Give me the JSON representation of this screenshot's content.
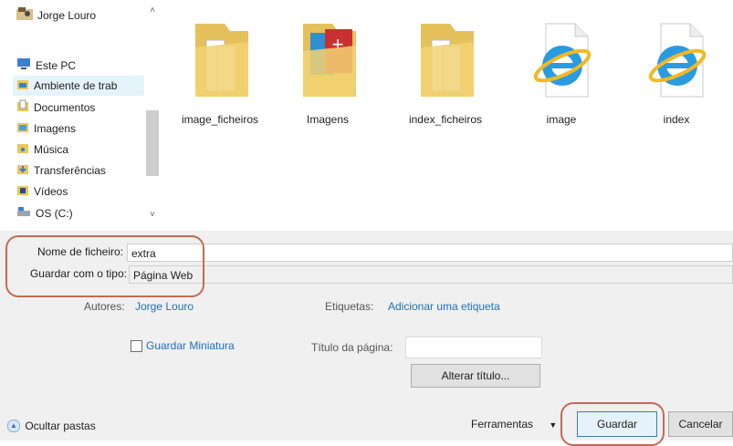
{
  "nav": {
    "items": [
      {
        "label": "Jorge Louro",
        "icon": "user-folder-icon"
      },
      {
        "label": "Este PC",
        "icon": "computer-icon"
      },
      {
        "label": "Ambiente de trab",
        "icon": "desktop-folder-icon"
      },
      {
        "label": "Documentos",
        "icon": "documents-folder-icon"
      },
      {
        "label": "Imagens",
        "icon": "pictures-folder-icon"
      },
      {
        "label": "Música",
        "icon": "music-folder-icon"
      },
      {
        "label": "Transferências",
        "icon": "downloads-folder-icon"
      },
      {
        "label": "Vídeos",
        "icon": "videos-folder-icon"
      },
      {
        "label": "OS (C:)",
        "icon": "drive-icon"
      }
    ]
  },
  "files": [
    {
      "label": "image_ficheiros",
      "icon": "folder-icon"
    },
    {
      "label": "Imagens",
      "icon": "folder-app-icon"
    },
    {
      "label": "index_ficheiros",
      "icon": "folder-icon"
    },
    {
      "label": "image",
      "icon": "ie-document-icon"
    },
    {
      "label": "index",
      "icon": "ie-document-icon"
    }
  ],
  "form": {
    "filename_label": "Nome de ficheiro:",
    "filename_value": "extra",
    "type_label": "Guardar com o tipo:",
    "type_value": "Página Web",
    "authors_label": "Autores:",
    "authors_value": "Jorge Louro",
    "tags_label": "Etiquetas:",
    "tags_value": "Adicionar uma etiqueta",
    "thumbnail_label": "Guardar Miniatura",
    "page_title_label": "Título da página:",
    "change_title_button": "Alterar título..."
  },
  "footer": {
    "hide_folders": "Ocultar pastas",
    "tools": "Ferramentas",
    "save": "Guardar",
    "cancel": "Cancelar"
  },
  "colors": {
    "accent": "#1f6ebf",
    "highlight": "#c46a55"
  }
}
